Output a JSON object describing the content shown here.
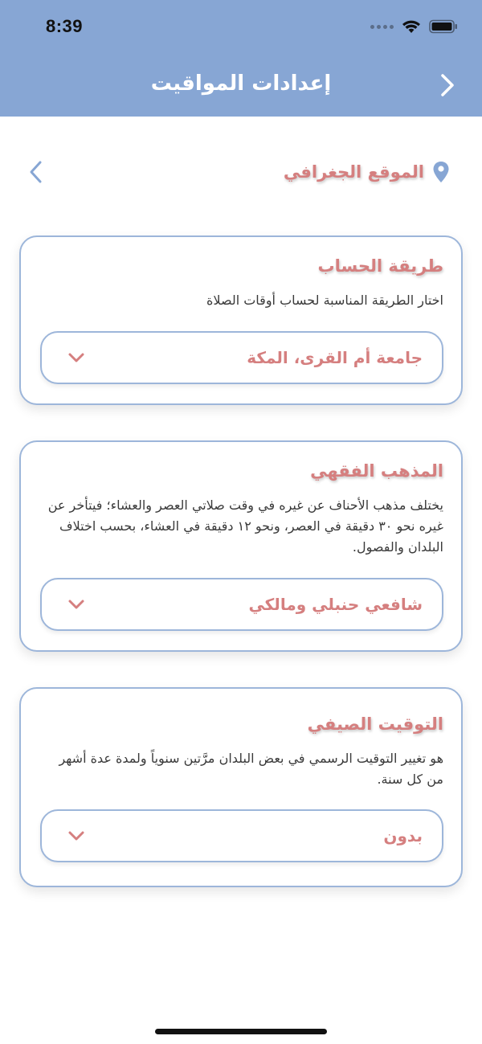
{
  "status_bar": {
    "time": "8:39"
  },
  "header": {
    "title": "إعدادات المواقيت"
  },
  "location": {
    "label": "الموقع الجغرافي"
  },
  "cards": [
    {
      "title": "طريقة الحساب",
      "description": "اختار الطريقة المناسبة لحساب أوقات الصلاة",
      "selected": "جامعة أم القرى، المكة"
    },
    {
      "title": "المذهب الفقهي",
      "description": "يختلف مذهب الأحناف عن غيره في وقت صلاتي العصر والعشاء؛ فيتأخر عن غيره نحو ٣٠ دقيقة في العصر، ونحو ١٢ دقيقة في العشاء، بحسب اختلاف البلدان والفصول.",
      "selected": "شافعي حنبلي ومالكي"
    },
    {
      "title": "التوقيت الصيفي",
      "description": "هو تغيير التوقيت الرسمي في بعض البلدان مرَّتين سنوياً ولمدة عدة أشهر من كل سنة.",
      "selected": "بدون"
    }
  ],
  "colors": {
    "header_bg": "#87a6d4",
    "accent_text": "#d57f7f",
    "border": "#9db6da"
  },
  "icons": {
    "back": "chevron-right-icon",
    "location": "map-pin-icon",
    "location_arrow": "chevron-left-icon",
    "select": "chevron-down-icon"
  }
}
